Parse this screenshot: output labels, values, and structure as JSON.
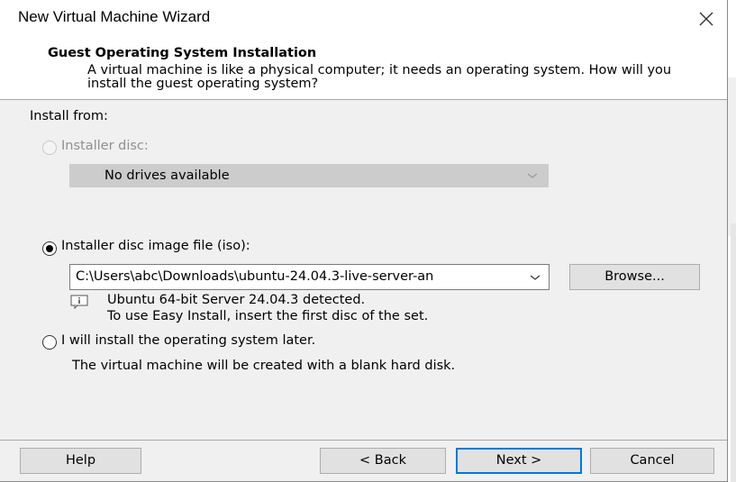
{
  "window": {
    "title": "New Virtual Machine Wizard"
  },
  "header": {
    "title": "Guest Operating System Installation",
    "description": "A virtual machine is like a physical computer; it needs an operating system. How will you install the guest operating system?"
  },
  "install_from": {
    "label": "Install from:",
    "options": [
      {
        "label": "Installer disc:",
        "selected": false,
        "enabled": false
      },
      {
        "label": "Installer disc image file (iso):",
        "selected": true,
        "enabled": true
      },
      {
        "label": "I will install the operating system later.",
        "selected": false,
        "enabled": true
      }
    ],
    "disc_dropdown_value": "No drives available",
    "iso_path_value": "C:\\Users\\abc\\Downloads\\ubuntu-24.04.3-live-server-an",
    "browse_label": "Browse...",
    "detected_line1": "Ubuntu 64-bit Server 24.04.3 detected.",
    "detected_line2": "To use Easy Install, insert the first disc of the set.",
    "later_description": "The virtual machine will be created with a blank hard disk."
  },
  "footer": {
    "help_label": "Help",
    "back_label": "< Back",
    "next_label": "Next >",
    "cancel_label": "Cancel"
  },
  "colors": {
    "accent": "#0078d7",
    "dialog_bg": "#f0f0f0",
    "header_bg": "#ffffff"
  },
  "icons": [
    "close-icon",
    "chevron-down-icon",
    "info-icon"
  ]
}
